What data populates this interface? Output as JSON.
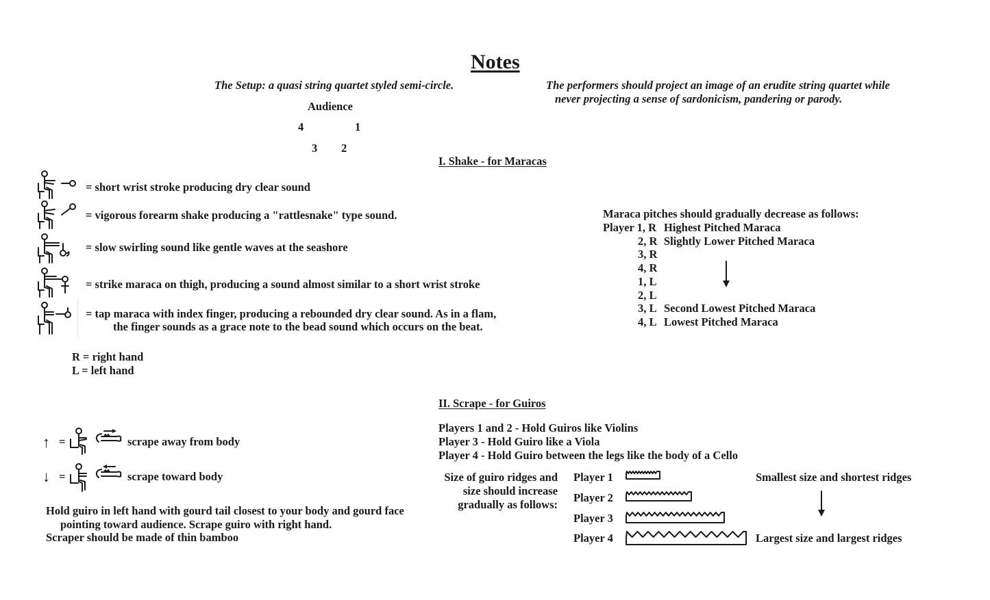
{
  "title": "Notes",
  "setup": {
    "heading": "The Setup: a quasi string quartet styled semi-circle.",
    "audience_label": "Audience",
    "positions": {
      "p4": "4",
      "p1": "1",
      "p3": "3",
      "p2": "2"
    }
  },
  "performance_note": {
    "line1": "The performers should project an image of an erudite string quartet while",
    "line2": "never projecting a sense of sardonicism, pandering or parody."
  },
  "section_shake": {
    "heading": "I. Shake - for Maracas",
    "symbols": [
      {
        "icon": "seated-player-short-wrist-stroke-icon",
        "text": "=  short wrist stroke producing dry clear sound"
      },
      {
        "icon": "seated-player-forearm-shake-icon",
        "text": "=  vigorous forearm shake producing a \"rattlesnake\" type sound."
      },
      {
        "icon": "seated-player-swirl-icon",
        "text": "=  slow swirling sound like gentle waves at the seashore"
      },
      {
        "icon": "seated-player-thigh-strike-icon",
        "text": "=  strike maraca on thigh, producing a sound almost similar to a short wrist stroke"
      },
      {
        "icon": "seated-player-finger-tap-icon",
        "text": "=  tap maraca with index finger, producing a rebounded dry clear sound.  As in a flam,",
        "text2": "the finger sounds as a grace note to the bead sound which occurs on the beat."
      }
    ],
    "hands": {
      "r": "R  =  right hand",
      "l": "L  =  left hand"
    },
    "pitches": {
      "intro": "Maraca pitches should gradually decrease as follows:",
      "rows": [
        {
          "label": "Player 1, R",
          "desc": "Highest Pitched Maraca"
        },
        {
          "label": "2, R",
          "desc": "Slightly Lower Pitched Maraca"
        },
        {
          "label": "3, R",
          "desc": ""
        },
        {
          "label": "4, R",
          "desc": ""
        },
        {
          "label": "1, L",
          "desc": ""
        },
        {
          "label": "2, L",
          "desc": ""
        },
        {
          "label": "3, L",
          "desc": "Second Lowest Pitched Maraca"
        },
        {
          "label": "4, L",
          "desc": "Lowest Pitched Maraca"
        }
      ]
    }
  },
  "section_scrape": {
    "heading": "II. Scrape - for Guiros",
    "holds": [
      "Players 1 and 2 - Hold Guiros like Violins",
      "Player 3 - Hold Guiro like a Viola",
      "Player 4 - Hold Guiro between the legs like the body of a Cello"
    ],
    "symbols": [
      {
        "arrow": "↑",
        "eq": "=",
        "text": "scrape away from body"
      },
      {
        "arrow": "↓",
        "eq": "=",
        "text": "scrape toward body"
      }
    ],
    "instructions": [
      "Hold guiro in left hand with gourd tail closest to your body and gourd face",
      "pointing toward audience.  Scrape guiro with right hand.",
      "Scraper should be made of thin bamboo"
    ],
    "size_intro": [
      "Size of guiro ridges and",
      "size should increase",
      "gradually as follows:"
    ],
    "players": [
      {
        "label": "Player 1",
        "ridge_count": 10
      },
      {
        "label": "Player 2",
        "ridge_count": 14
      },
      {
        "label": "Player 3",
        "ridge_count": 17
      },
      {
        "label": "Player 4",
        "ridge_count": 11
      }
    ],
    "smallest_label": "Smallest size and shortest ridges",
    "largest_label": "Largest size and largest ridges"
  }
}
